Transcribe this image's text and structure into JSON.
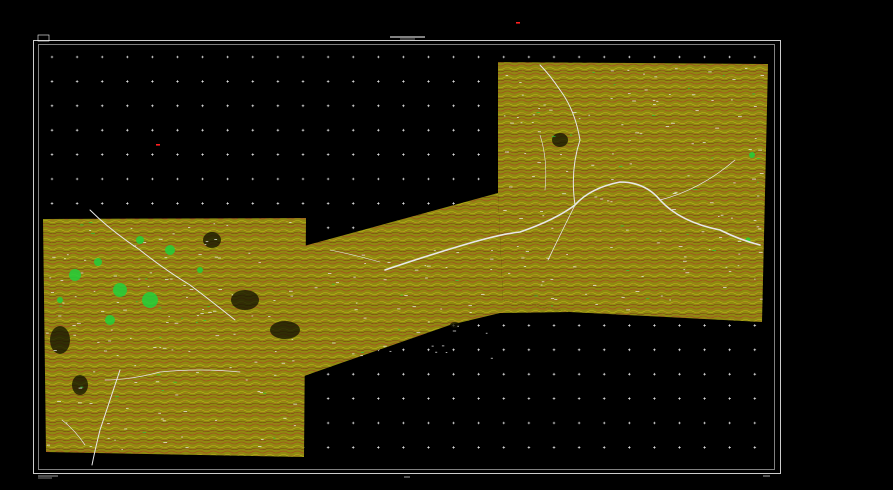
{
  "drawing": {
    "title_block_text": "",
    "scale_note": "",
    "sheet_number": ""
  },
  "colors": {
    "background": "#000000",
    "frame": "#ffffff",
    "grid_cross": "#ffffff",
    "terrain_base": "#8f8a10",
    "contour_primary": "#a0521e",
    "contour_secondary": "#c2b81a",
    "river": "#e8e8e8",
    "vegetation": "#22d03a",
    "marker": "#ff2020"
  },
  "icons": {
    "north_marker": "red-dash-marker",
    "grid_mark": "plus-cross"
  }
}
